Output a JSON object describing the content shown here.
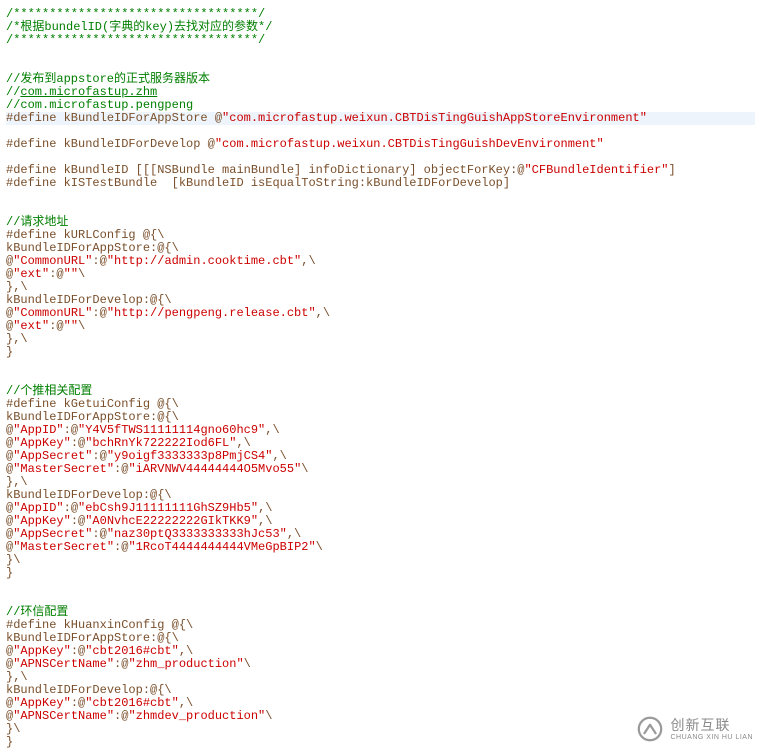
{
  "commentBlock": {
    "bar": "/**********************************/",
    "desc": "/*根据bundelID(字典的key)去找对应的参数*/"
  },
  "publishComment": "//发布到appstore的正式服务器版本",
  "slashes": "//",
  "link1": "com.microfastup.zhm",
  "link2Line": "//com.microfastup.pengpeng",
  "defineAppStore": {
    "prefix": "#define kBundleIDForAppStore @",
    "str": "\"com.microfastup.weixun.CBTDisTingGuishAppStoreEnvironment\""
  },
  "defineDevelop": {
    "prefix": "#define kBundleIDForDevelop @",
    "str": "\"com.microfastup.weixun.CBTDisTingGuishDevEnvironment\""
  },
  "defineBundleID": {
    "prefix": "#define kBundleID [[[NSBundle mainBundle] infoDictionary] objectForKey:@",
    "str": "\"CFBundleIdentifier\"",
    "suffix": "]"
  },
  "defineIsTest": "#define kISTestBundle  [kBundleID isEqualToString:kBundleIDForDevelop]",
  "reqAddrComment": "//请求地址",
  "urlcfg": {
    "l1": "#define kURLConfig @{\\",
    "l2": "kBundleIDForAppStore:@{\\",
    "l3_at": "@",
    "l3_k": "\"CommonURL\"",
    "l3_colon": ":@",
    "l3_v": "\"http://admin.cooktime.cbt\"",
    "l3_tail": ",\\",
    "l4_at": "@",
    "l4_k": "\"ext\"",
    "l4_colon": ":@",
    "l4_v": "\"\"",
    "l4_tail": "\\",
    "l5": "},\\",
    "l6": "kBundleIDForDevelop:@{\\",
    "l7_at": "@",
    "l7_k": "\"CommonURL\"",
    "l7_colon": ":@",
    "l7_v": "\"http://pengpeng.release.cbt\"",
    "l7_tail": ",\\",
    "l8_at": "@",
    "l8_k": "\"ext\"",
    "l8_colon": ":@",
    "l8_v": "\"\"",
    "l8_tail": "\\",
    "l9": "},\\",
    "l10": "}"
  },
  "getuiComment": "//个推相关配置",
  "getui": {
    "l1": "#define kGetuiConfig @{\\",
    "l2": "kBundleIDForAppStore:@{\\",
    "r1_at": "@",
    "r1_k": "\"AppID\"",
    "r1_c": ":@",
    "r1_v": "\"Y4V5fTWS11111114gno60hc9\"",
    "r1_t": ",\\",
    "r2_at": "@",
    "r2_k": "\"AppKey\"",
    "r2_c": ":@",
    "r2_v": "\"bchRnYk722222Iod6FL\"",
    "r2_t": ",\\",
    "r3_at": "@",
    "r3_k": "\"AppSecret\"",
    "r3_c": ":@",
    "r3_v": "\"y9oigf3333333p8PmjCS4\"",
    "r3_t": ",\\",
    "r4_at": "@",
    "r4_k": "\"MasterSecret\"",
    "r4_c": ":@",
    "r4_v": "\"iARVNWV44444444O5Mvo55\"",
    "r4_t": "\\",
    "l5": "},\\",
    "l6": "kBundleIDForDevelop:@{\\",
    "s1_at": "@",
    "s1_k": "\"AppID\"",
    "s1_c": ":@",
    "s1_v": "\"ebCsh9J11111111GhSZ9Hb5\"",
    "s1_t": ",\\",
    "s2_at": "@",
    "s2_k": "\"AppKey\"",
    "s2_c": ":@",
    "s2_v": "\"A0NvhcE22222222GIkTKK9\"",
    "s2_t": ",\\",
    "s3_at": "@",
    "s3_k": "\"AppSecret\"",
    "s3_c": ":@",
    "s3_v": "\"naz30ptQ3333333333hJc53\"",
    "s3_t": ",\\",
    "s4_at": "@",
    "s4_k": "\"MasterSecret\"",
    "s4_c": ":@",
    "s4_v": "\"1RcoT4444444444VMeGpBIP2\"",
    "s4_t": "\\",
    "l9": "}\\",
    "l10": "}"
  },
  "huanxinComment": "//环信配置",
  "huanxin": {
    "l1": "#define kHuanxinConfig @{\\",
    "l2": "kBundleIDForAppStore:@{\\",
    "r1_at": "@",
    "r1_k": "\"AppKey\"",
    "r1_c": ":@",
    "r1_v": "\"cbt2016#cbt\"",
    "r1_t": ",\\",
    "r2_at": "@",
    "r2_k": "\"APNSCertName\"",
    "r2_c": ":@",
    "r2_v": "\"zhm_production\"",
    "r2_t": "\\",
    "l5": "},\\",
    "l6": "kBundleIDForDevelop:@{\\",
    "s1_at": "@",
    "s1_k": "\"AppKey\"",
    "s1_c": ":@",
    "s1_v": "\"cbt2016#cbt\"",
    "s1_t": ",\\",
    "s2_at": "@",
    "s2_k": "\"APNSCertName\"",
    "s2_c": ":@",
    "s2_v": "\"zhmdev_production\"",
    "s2_t": "\\",
    "l9": "}\\",
    "l10": "}"
  },
  "watermark": {
    "zh": "创新互联",
    "en": "CHUANG XIN HU LIAN"
  }
}
